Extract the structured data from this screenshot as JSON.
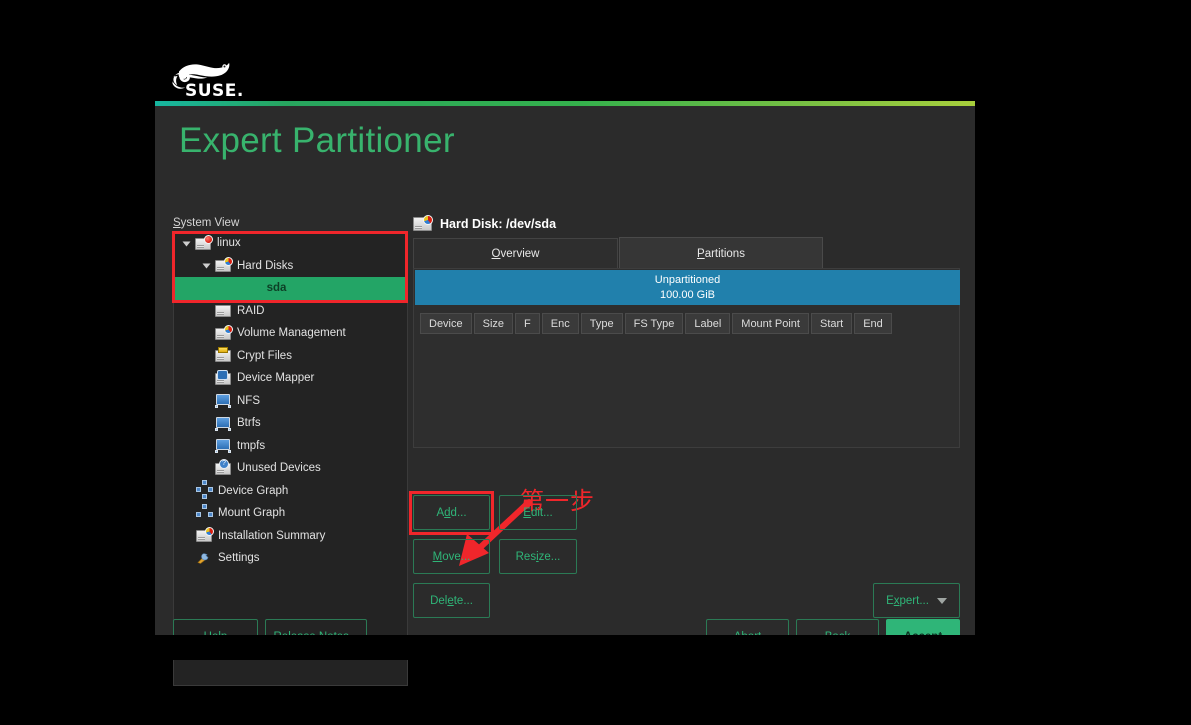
{
  "window": {
    "title": "Expert Partitioner",
    "brand": "SUSE"
  },
  "sidebar": {
    "label": "System View",
    "label_mnemonic": "S",
    "items": [
      {
        "label": "linux",
        "icon": "hard-disk-icon",
        "indent": 0,
        "twisty": "down",
        "selected": false
      },
      {
        "label": "Hard Disks",
        "icon": "hard-disk-icon",
        "indent": 1,
        "twisty": "down",
        "selected": false
      },
      {
        "label": "sda",
        "icon": "none",
        "indent": 2,
        "twisty": "none",
        "selected": true
      },
      {
        "label": "RAID",
        "icon": "raid-icon",
        "indent": 1,
        "twisty": "none",
        "selected": false
      },
      {
        "label": "Volume Management",
        "icon": "volume-management-icon",
        "indent": 1,
        "twisty": "none",
        "selected": false
      },
      {
        "label": "Crypt Files",
        "icon": "crypt-files-icon",
        "indent": 1,
        "twisty": "none",
        "selected": false
      },
      {
        "label": "Device Mapper",
        "icon": "device-mapper-icon",
        "indent": 1,
        "twisty": "none",
        "selected": false
      },
      {
        "label": "NFS",
        "icon": "nfs-folder-icon",
        "indent": 1,
        "twisty": "none",
        "selected": false
      },
      {
        "label": "Btrfs",
        "icon": "btrfs-folder-icon",
        "indent": 1,
        "twisty": "none",
        "selected": false
      },
      {
        "label": "tmpfs",
        "icon": "tmpfs-folder-icon",
        "indent": 1,
        "twisty": "none",
        "selected": false
      },
      {
        "label": "Unused Devices",
        "icon": "unused-devices-icon",
        "indent": 1,
        "twisty": "none",
        "selected": false
      },
      {
        "label": "Device Graph",
        "icon": "device-graph-icon",
        "indent": 0,
        "twisty": "none",
        "selected": false
      },
      {
        "label": "Mount Graph",
        "icon": "mount-graph-icon",
        "indent": 0,
        "twisty": "none",
        "selected": false
      },
      {
        "label": "Installation Summary",
        "icon": "installation-summary-icon",
        "indent": 0,
        "twisty": "none",
        "selected": false
      },
      {
        "label": "Settings",
        "icon": "settings-wrench-icon",
        "indent": 0,
        "twisty": "none",
        "selected": false
      }
    ]
  },
  "main": {
    "heading": "Hard Disk: /dev/sda",
    "heading_icon": "hard-disk-icon",
    "tabs": [
      {
        "label": "Overview",
        "mnemonic": "O",
        "active": false
      },
      {
        "label": "Partitions",
        "mnemonic": "P",
        "active": true
      }
    ],
    "capacity": {
      "label": "Unpartitioned",
      "size": "100.00 GiB",
      "color": "#2180ac"
    },
    "table": {
      "columns": [
        "Device",
        "Size",
        "F",
        "Enc",
        "Type",
        "FS Type",
        "Label",
        "Mount Point",
        "Start",
        "End"
      ],
      "rows": []
    }
  },
  "actions": {
    "add": {
      "label": "Add...",
      "mnemonic": "d"
    },
    "edit": {
      "label": "Edit...",
      "mnemonic": "E"
    },
    "move": {
      "label": "Move...",
      "mnemonic": "M"
    },
    "resize": {
      "label": "Resize...",
      "mnemonic": "i"
    },
    "delete": {
      "label": "Delete...",
      "mnemonic": "e"
    },
    "expert": {
      "label": "Expert...",
      "mnemonic": "x",
      "caret": "chevron-down-icon"
    }
  },
  "footer": {
    "help": {
      "label": "Help",
      "mnemonic": "H"
    },
    "release_notes": {
      "label": "Release Notes...",
      "mnemonic": "l"
    },
    "abort": {
      "label": "Abort",
      "mnemonic": "r"
    },
    "back": {
      "label": "Back",
      "mnemonic": "B"
    },
    "accept": {
      "label": "Accept",
      "mnemonic": "A"
    }
  },
  "annotations": {
    "step_text": "第一步",
    "color": "#f0262b"
  },
  "colors": {
    "accent_green": "#2fb578",
    "title_green": "#38b36d",
    "selection_green": "#23a566",
    "capacity_blue": "#2180ac",
    "annotation_red": "#f0262b",
    "window_bg": "#2b2b2b",
    "panel_bg": "#232323"
  }
}
